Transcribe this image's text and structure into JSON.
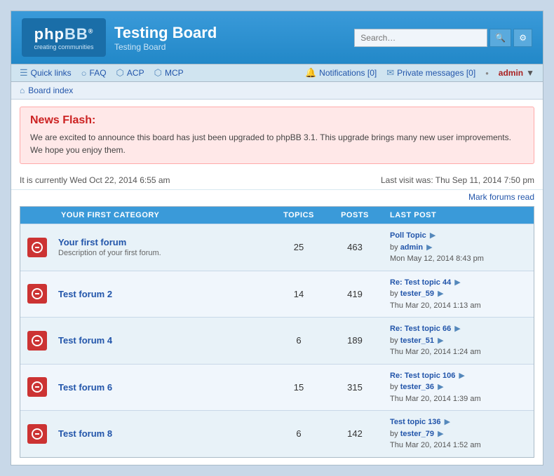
{
  "header": {
    "logo_text": "phpBB",
    "logo_tagline": "®\ncreating communities",
    "board_title": "Testing Board",
    "board_subtitle": "Testing Board",
    "search_placeholder": "Search…",
    "search_icon": "🔍",
    "adv_search_icon": "⚙"
  },
  "navbar": {
    "quick_links_label": "Quick links",
    "faq_label": "FAQ",
    "acp_label": "ACP",
    "mcp_label": "MCP",
    "notifications_label": "Notifications",
    "notifications_count": "0",
    "private_messages_label": "Private messages",
    "private_messages_count": "0",
    "admin_user": "admin",
    "admin_arrow": "▼"
  },
  "breadcrumb": {
    "board_index_label": "Board index"
  },
  "news_flash": {
    "title": "News Flash:",
    "body": "We are excited to announce this board has just been upgraded to phpBB 3.1. This upgrade brings many new user improvements. We hope you enjoy them."
  },
  "info_bar": {
    "current_time": "It is currently Wed Oct 22, 2014 6:55 am",
    "last_visit": "Last visit was: Thu Sep 11, 2014 7:50 pm"
  },
  "mark_forums_read": "Mark forums read",
  "forum_table": {
    "category_label": "YOUR FIRST CATEGORY",
    "col_topics": "TOPICS",
    "col_posts": "POSTS",
    "col_lastpost": "LAST POST",
    "forums": [
      {
        "name": "Your first forum",
        "desc": "Description of your first forum.",
        "topics": "25",
        "posts": "463",
        "last_topic": "Poll Topic",
        "last_by": "by",
        "last_user": "admin",
        "last_date": "Mon May 12, 2014 8:43 pm"
      },
      {
        "name": "Test forum 2",
        "desc": "",
        "topics": "14",
        "posts": "419",
        "last_topic": "Re: Test topic 44",
        "last_by": "by",
        "last_user": "tester_59",
        "last_date": "Thu Mar 20, 2014 1:13 am"
      },
      {
        "name": "Test forum 4",
        "desc": "",
        "topics": "6",
        "posts": "189",
        "last_topic": "Re: Test topic 66",
        "last_by": "by",
        "last_user": "tester_51",
        "last_date": "Thu Mar 20, 2014 1:24 am"
      },
      {
        "name": "Test forum 6",
        "desc": "",
        "topics": "15",
        "posts": "315",
        "last_topic": "Re: Test topic 106",
        "last_by": "by",
        "last_user": "tester_36",
        "last_date": "Thu Mar 20, 2014 1:39 am"
      },
      {
        "name": "Test forum 8",
        "desc": "",
        "topics": "6",
        "posts": "142",
        "last_topic": "Test topic 136",
        "last_by": "by",
        "last_user": "tester_79",
        "last_date": "Thu Mar 20, 2014 1:52 am"
      }
    ]
  }
}
